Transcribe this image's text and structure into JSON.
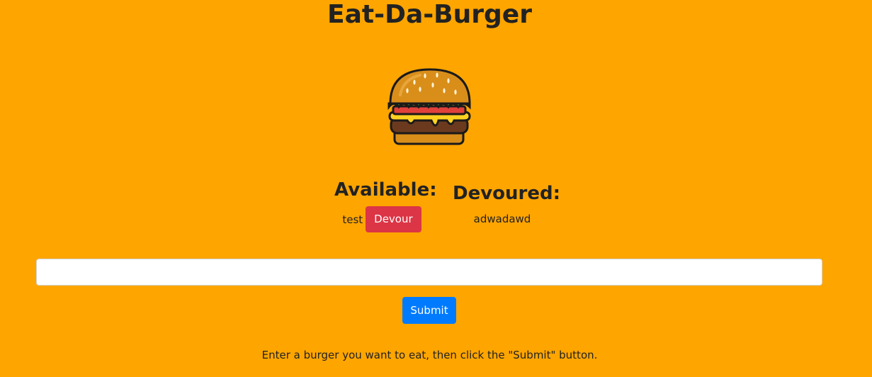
{
  "page": {
    "title": "Eat-Da-Burger",
    "logo_icon": "burger-icon"
  },
  "available": {
    "heading": "Available:",
    "items": [
      {
        "name": "test",
        "button_label": "Devour"
      }
    ]
  },
  "devoured": {
    "heading": "Devoured:",
    "items": [
      {
        "name": "adwadawd"
      }
    ]
  },
  "form": {
    "input_value": "",
    "input_placeholder": "",
    "submit_label": "Submit",
    "instructions": "Enter a burger you want to eat, then click the \"Submit\" button."
  },
  "colors": {
    "background": "#FFA500",
    "devour_button": "#dc3545",
    "submit_button": "#007bff"
  }
}
